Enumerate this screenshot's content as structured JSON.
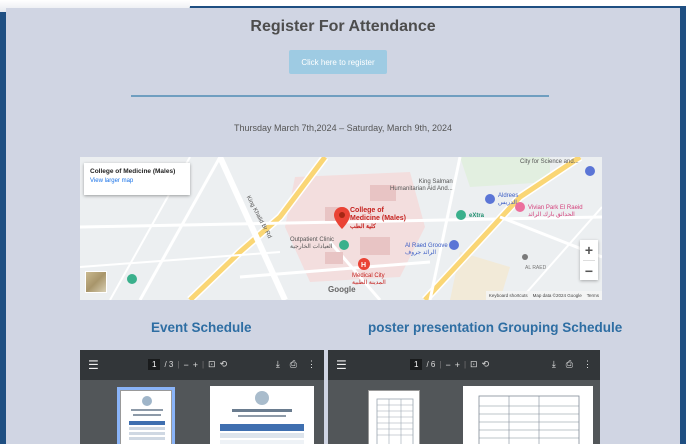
{
  "header": {
    "title": "Register For Attendance",
    "register_button": "Click here to register",
    "dates": "Thursday March 7th,2024 – Saturday, March 9th, 2024"
  },
  "map": {
    "card_title": "College of Medicine (Males)",
    "card_link": "View larger map",
    "labels": {
      "college_en": "College of",
      "college_en2": "Medicine (Males)",
      "college_ar": "كلية الطب",
      "king_salman": "King Salman",
      "king_salman2": "Humanitarian Aid And...",
      "king_salman_ar": "مركز الملك سلمان للإغاثة والأعمال الإنسانية",
      "aldrees": "Aldrees",
      "aldrees_ar": "الدريس",
      "extra": "eXtra",
      "extra_ar": "اكسترا",
      "vivian": "Vivian Park El Raeid",
      "vivian_ar": "الحدائق بارك الرائد",
      "outpatient": "Outpatient Clinic",
      "outpatient_ar": "العيادات الخارجية",
      "alraed_groove": "Al Raed Groove",
      "alraed_groove_ar": "الرائد جروف",
      "medical_city": "Medical City",
      "medical_city_ar": "المدينة الطبية",
      "city_science": "City for Science and...",
      "city_science_ar": "مدينة الملك عبدالعزيز للعلوم",
      "king_road": "King Khalid Br Rd",
      "al_raed": "AL RAED",
      "al_raed_ar": "الرائد",
      "google": "Google"
    },
    "attribution": {
      "shortcuts": "Keyboard shortcuts",
      "data": "Map data ©2024 Google",
      "terms": "Terms"
    },
    "zoom_in": "+",
    "zoom_out": "−"
  },
  "sections": {
    "event_schedule": "Event Schedule",
    "poster_schedule": "poster presentation Grouping Schedule"
  },
  "viewer_left": {
    "menu": "☰",
    "page": "1",
    "total": "/ 3",
    "minus": "−",
    "plus": "+"
  },
  "viewer_right": {
    "menu": "☰",
    "page": "1",
    "total": "/ 6",
    "minus": "−",
    "plus": "+"
  },
  "colors": {
    "background": "#1f4f82",
    "panel": "#d0d5e3",
    "title_text": "#4d4d4d",
    "button": "#9ecbe3",
    "section_title": "#2e6ea3",
    "pdf_toolbar": "#323639",
    "map_pin": "#ea4335"
  }
}
